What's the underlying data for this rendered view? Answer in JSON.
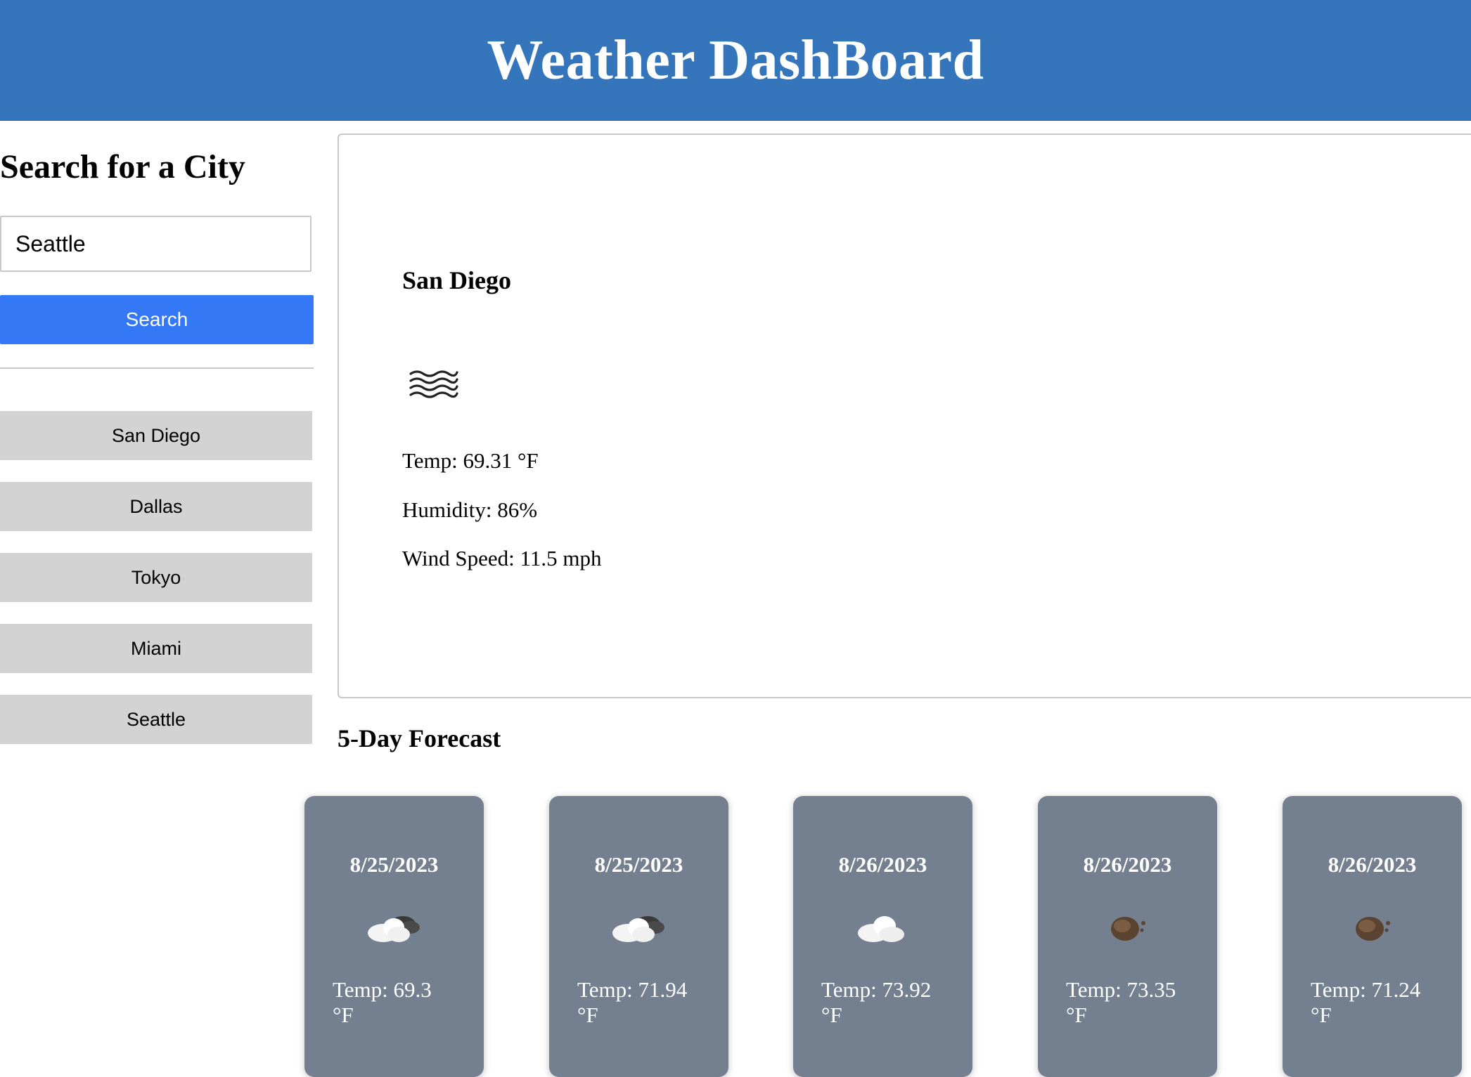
{
  "header": {
    "title": "Weather DashBoard"
  },
  "sidebar": {
    "heading": "Search for a City",
    "search_value": "Seattle",
    "search_button_label": "Search",
    "history": [
      "San Diego",
      "Dallas",
      "Tokyo",
      "Miami",
      "Seattle"
    ]
  },
  "current": {
    "city": "San Diego",
    "icon": "mist-icon",
    "temp_text": "Temp: 69.31 °F",
    "humidity_text": "Humidity: 86%",
    "wind_text": "Wind Speed: 11.5 mph"
  },
  "forecast": {
    "title": "5-Day Forecast",
    "days": [
      {
        "date": "8/25/2023",
        "icon": "partly-cloudy-icon",
        "temp_value": "Temp: 69.3",
        "temp_unit": "°F"
      },
      {
        "date": "8/25/2023",
        "icon": "partly-cloudy-icon",
        "temp_value": "Temp: 71.94",
        "temp_unit": "°F"
      },
      {
        "date": "8/26/2023",
        "icon": "cloud-icon",
        "temp_value": "Temp: 73.92",
        "temp_unit": "°F"
      },
      {
        "date": "8/26/2023",
        "icon": "broken-clouds-icon",
        "temp_value": "Temp: 73.35",
        "temp_unit": "°F"
      },
      {
        "date": "8/26/2023",
        "icon": "broken-clouds-icon",
        "temp_value": "Temp: 71.24",
        "temp_unit": "°F"
      }
    ]
  },
  "colors": {
    "header_bg": "#3575bb",
    "search_button": "#3478f6",
    "history_button": "#d3d3d3",
    "forecast_card": "#747f8f"
  }
}
